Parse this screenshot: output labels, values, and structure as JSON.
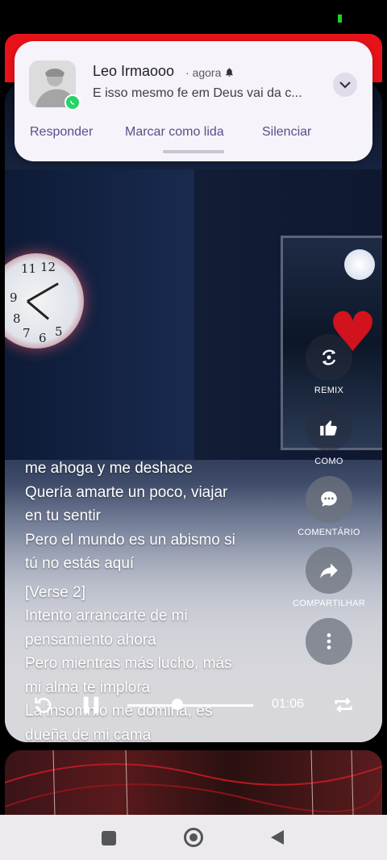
{
  "notification": {
    "sender": "Leo Irmaooo",
    "separator": "·",
    "time": "agora",
    "message": "E isso mesmo fe em Deus vai da c...",
    "actions": [
      "Responder",
      "Marcar como lida",
      "Silenciar"
    ],
    "app_icon": "whatsapp-icon",
    "bell_icon": "bell-icon"
  },
  "lyrics": {
    "lines_block1": [
      "me ahoga y me deshace",
      "Quería amarte un poco, viajar",
      "en tu sentir",
      "Pero el mundo es un abismo si",
      "tú no estás aquí"
    ],
    "lines_block2": [
      "[Verse 2]",
      "Intento arrancarte de mi",
      "pensamiento ahora",
      "Pero mientras más lucho, más",
      "mi alma te implora",
      "La insomnio me domina, es",
      "dueña de mi cama"
    ]
  },
  "side_actions": {
    "remix": "REMIX",
    "like": "COMO",
    "comment": "COMENTÁRIO",
    "share": "COMPARTILHAR"
  },
  "player": {
    "time": "01:06",
    "progress": 0.4
  },
  "clock_numbers": [
    "11",
    "12",
    "9",
    "8",
    "7",
    "6",
    "5"
  ],
  "colors": {
    "accent": "#5b4e8a",
    "top_red": "#e8121a",
    "status_green": "#1fd21f"
  }
}
